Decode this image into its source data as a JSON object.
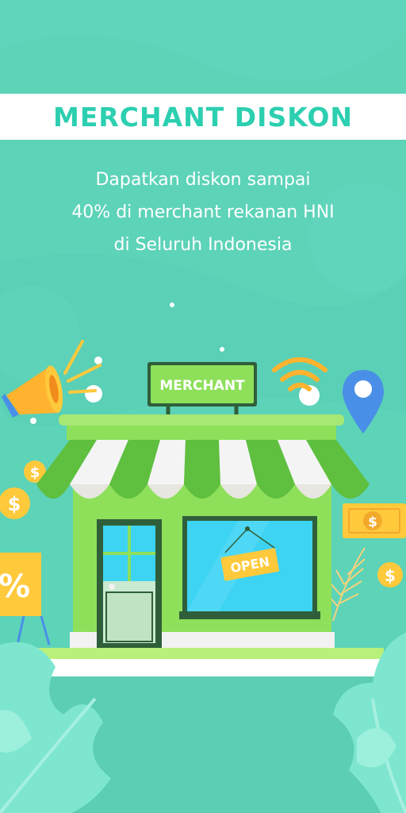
{
  "banner": {
    "title": "MERCHANT DISKON"
  },
  "subtitle": {
    "line1": "Dapatkan diskon sampai",
    "line2": "40% di merchant rekanan HNI",
    "line3": "di Seluruh Indonesia"
  },
  "illustration": {
    "store_sign": "MERCHANT",
    "window_sign": "OPEN",
    "discount_sign": "%",
    "coin_symbol": "$"
  },
  "colors": {
    "background": "#5dd3b8",
    "accent": "#2ccfb0",
    "store_green": "#8ee05a",
    "awning_dark": "#5fbf3e",
    "window_blue": "#3dd3f2",
    "coin_yellow": "#ffc93c",
    "pin_blue": "#4a8fe7",
    "wifi_orange": "#ffb32e"
  }
}
